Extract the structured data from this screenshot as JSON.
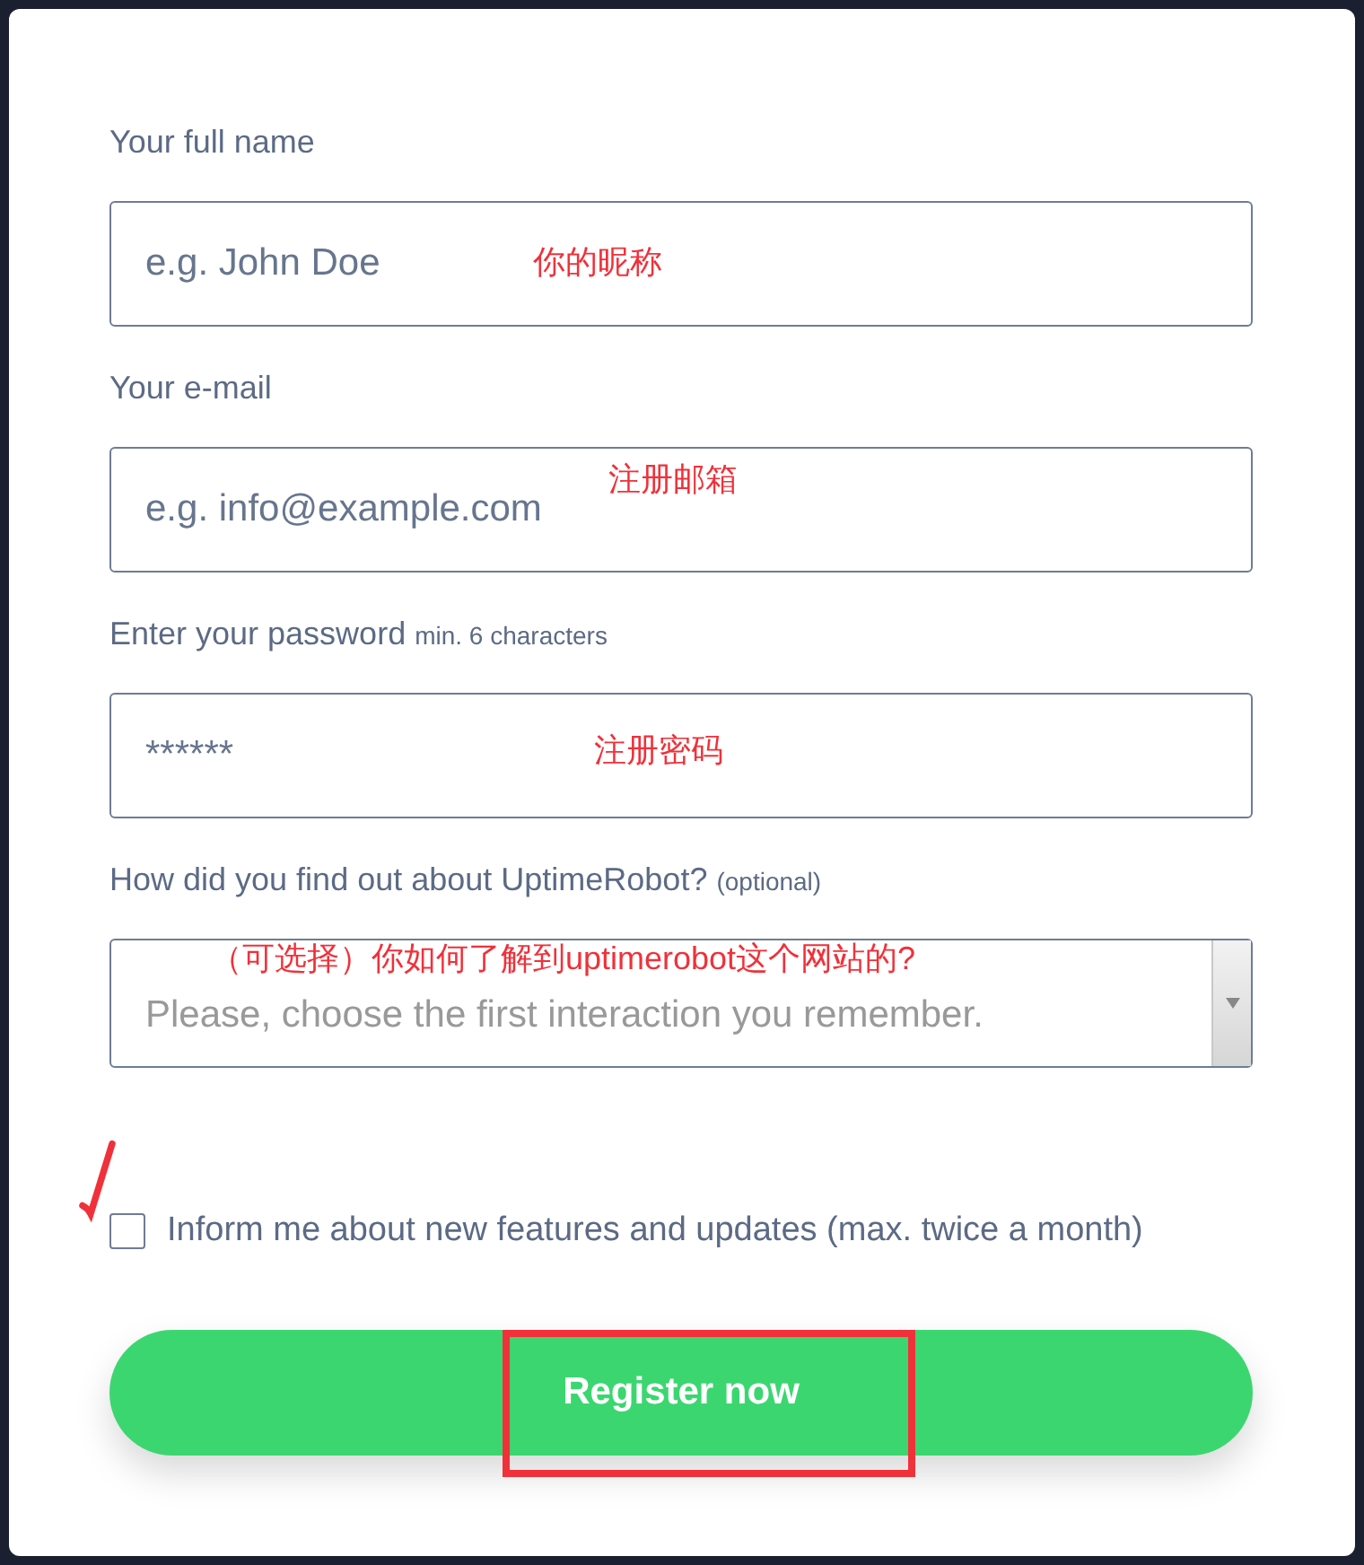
{
  "form": {
    "fields": [
      {
        "kind": "text",
        "label": "Your full name",
        "placeholder": "e.g. John Doe",
        "note": "你的昵称"
      },
      {
        "kind": "text",
        "label": "Your e-mail",
        "placeholder": "e.g. info@example.com",
        "note": "注册邮箱"
      },
      {
        "kind": "password",
        "label": "Enter your password",
        "hint": "min. 6 characters",
        "placeholder": "******",
        "note": "注册密码"
      },
      {
        "kind": "select",
        "label": "How did you find out about UptimeRobot?",
        "hint": "(optional)",
        "placeholder": "Please, choose the first interaction you remember.",
        "note": "（可选择）你如何了解到uptimerobot这个网站的?"
      }
    ],
    "newsletter": {
      "label": "Inform me about new features and updates (max. twice a month)",
      "checked": false
    },
    "submit": {
      "label": "Register now"
    }
  }
}
